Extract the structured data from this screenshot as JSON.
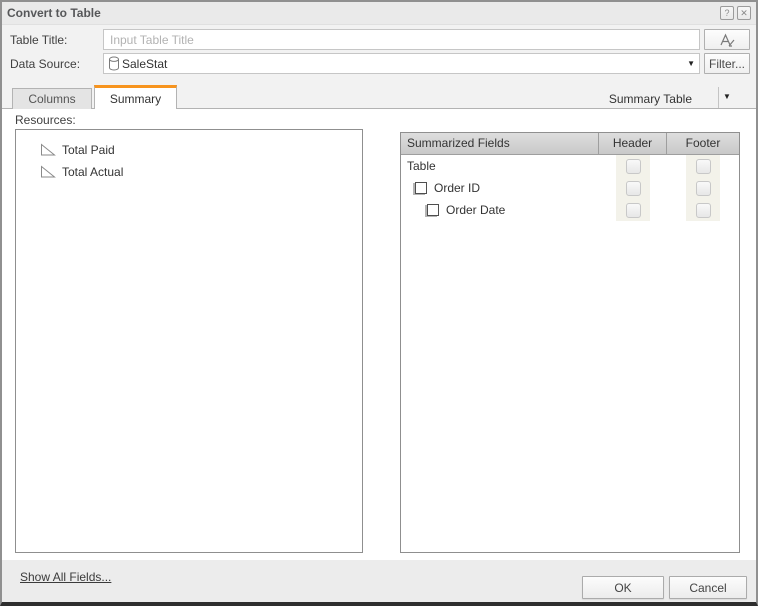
{
  "dialog": {
    "title": "Convert to Table"
  },
  "titlebar": {
    "help_glyph": "?",
    "close_glyph": "✕"
  },
  "fields": {
    "table_title": {
      "label": "Table Title:",
      "value": "",
      "placeholder": "Input Table Title"
    },
    "data_source": {
      "label": "Data Source:",
      "value": "SaleStat"
    },
    "font_style_button": {
      "glyph": "A"
    },
    "filter_button": {
      "label": "Filter..."
    }
  },
  "tabs": [
    {
      "label": "Columns",
      "active": false
    },
    {
      "label": "Summary",
      "active": true
    }
  ],
  "summary_type": {
    "selected": "Summary Table"
  },
  "resources": {
    "label": "Resources:",
    "items": [
      {
        "label": "Total Paid"
      },
      {
        "label": "Total Actual"
      }
    ]
  },
  "summary_table": {
    "columns": [
      "Summarized Fields",
      "Header",
      "Footer"
    ],
    "rows": [
      {
        "label": "Table",
        "indent": 0,
        "has_checkbox": false,
        "checked": false,
        "header_checked": false,
        "footer_checked": false
      },
      {
        "label": "Order ID",
        "indent": 1,
        "has_checkbox": true,
        "checked": false,
        "header_checked": false,
        "footer_checked": false
      },
      {
        "label": "Order Date",
        "indent": 2,
        "has_checkbox": true,
        "checked": false,
        "header_checked": false,
        "footer_checked": false
      }
    ]
  },
  "footer": {
    "show_all_link": "Show All Fields...",
    "ok_button": "OK",
    "cancel_button": "Cancel"
  },
  "colors": {
    "accent_tab": "#f7941e",
    "panel_border": "#8f8f8f",
    "header_gradient_top": "#dedede",
    "header_gradient_bottom": "#c9c9c9",
    "checkbox_band": "#f3f2ea"
  }
}
